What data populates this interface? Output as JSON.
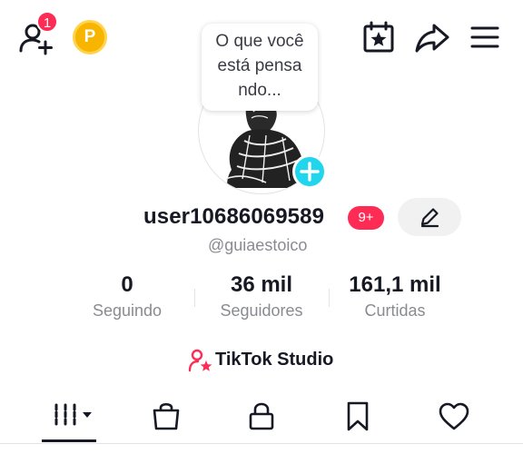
{
  "header": {
    "notification_count": "1",
    "coin_letter": "P"
  },
  "bubble": {
    "line1": "O que você",
    "line2": "está pensa",
    "line3": "ndo..."
  },
  "profile": {
    "username": "user10686069589",
    "badge": "9+",
    "handle": "@guiaestoico"
  },
  "stats": [
    {
      "value": "0",
      "label": "Seguindo"
    },
    {
      "value": "36 mil",
      "label": "Seguidores"
    },
    {
      "value": "161,1 mil",
      "label": "Curtidas"
    }
  ],
  "studio": {
    "label": "TikTok Studio"
  },
  "tabs": [
    {
      "icon": "videos-grid-icon",
      "active": true
    },
    {
      "icon": "shopping-bag-icon"
    },
    {
      "icon": "lock-icon"
    },
    {
      "icon": "bookmark-icon"
    },
    {
      "icon": "heart-icon"
    }
  ],
  "colors": {
    "accent": "#fe2c55",
    "add_avatar": "#20d5ec",
    "coin": "#f7b500",
    "muted_text": "#8a8b91"
  }
}
